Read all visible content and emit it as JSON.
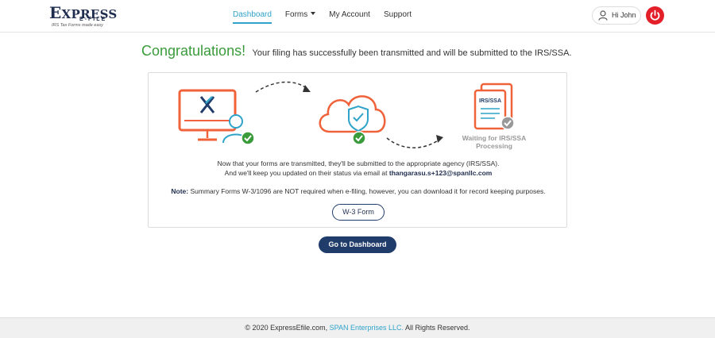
{
  "logo": {
    "main": "XPRESS",
    "x": "E",
    "sub": "E-FILE",
    "tagline": "IRS Tax Forms made easy"
  },
  "nav": {
    "items": [
      {
        "label": "Dashboard",
        "active": true
      },
      {
        "label": "Forms",
        "dropdown": true
      },
      {
        "label": "My Account"
      },
      {
        "label": "Support"
      }
    ]
  },
  "user": {
    "greeting": "Hi John"
  },
  "headline": {
    "title": "Congratulations!",
    "message": "Your filing has successfully been transmitted and will be submitted to the IRS/SSA."
  },
  "illustration": {
    "doc_label": "IRS/SSA",
    "waiting_line1": "Waiting for IRS/SSA",
    "waiting_line2": "Processing"
  },
  "card": {
    "message_line1": "Now that your forms are transmitted, they'll be submitted to the appropriate agency (IRS/SSA).",
    "message_line2_prefix": "And we'll keep you updated on their status via email at",
    "email": "thangarasu.s+123@spanllc.com",
    "note_label": "Note:",
    "note_text": "Summary Forms W-3/1096 are NOT required when e-filing, however, you can download it for record keeping purposes.",
    "w3_button": "W-3 Form"
  },
  "dashboard_button": "Go to Dashboard",
  "footer": {
    "prefix": "© 2020 ExpressEfile.com,",
    "link": "SPAN Enterprises LLC.",
    "suffix": "All Rights Reserved."
  },
  "colors": {
    "accent": "#2fa3c9",
    "brand_navy": "#1f3c6a",
    "success": "#3a9b3a",
    "orange": "#f0623a",
    "power": "#e3202a"
  }
}
